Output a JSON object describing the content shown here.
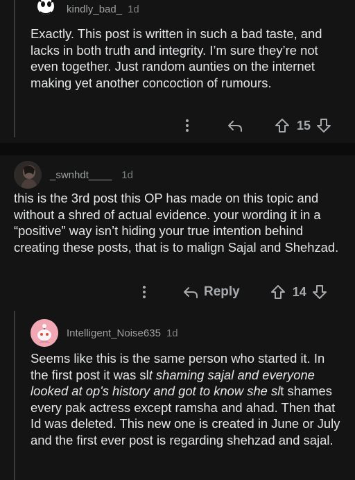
{
  "comments": [
    {
      "username": "kindly_bad_",
      "time": "1d",
      "body": "Exactly. This post is written in such a bad taste, and lacks in both truth and integrity. I’m sure they’re not even together. Just random aunties on the internet making yet another concoction of rumours.",
      "votes": "15"
    },
    {
      "username": "_swnhdt____",
      "time": "1d",
      "body": "this is the 3rd post this OP has made on this topic and without a shred of actual evidence. your wording it in a “positive” way isn’t hiding your true intention behind creating these posts, that is to malign Sajal and Shehzad.",
      "reply_label": "Reply",
      "votes": "14"
    },
    {
      "username": "Intelligent_Noise635",
      "time": "1d",
      "body_parts": [
        "Seems like this is the same person who started it. In the first post it was sl",
        "t shaming sajal and everyone looked at op's history and got to know she sl",
        "t shames every pak actress except ramsha and ahad. Then that Id was deleted. This new one is created in June or July and the first ever post is regarding shehzad and sajal."
      ]
    }
  ],
  "icons": {
    "more": "more-vertical-icon",
    "reply": "reply-arrow-icon",
    "upvote": "upvote-arrow-icon",
    "downvote": "downvote-arrow-icon"
  },
  "colors": {
    "background": "#0b0b0b",
    "card": "#141414",
    "text": "#e4e6e8",
    "muted": "#9ea1a4",
    "avatar_pink": "#f2a7b5"
  }
}
